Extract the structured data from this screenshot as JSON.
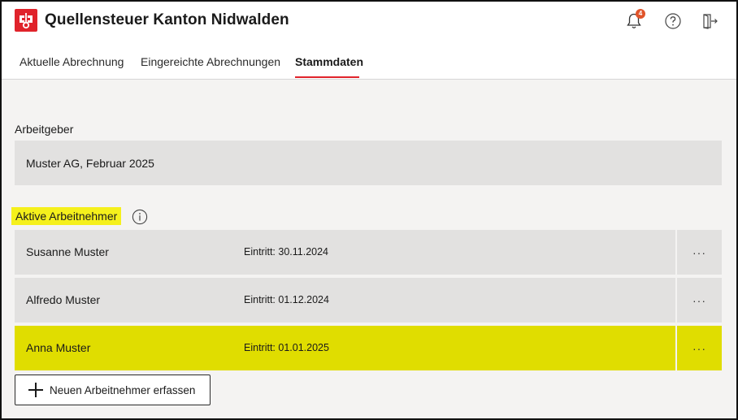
{
  "header": {
    "title": "Quellensteuer Kanton Nidwalden",
    "notification_count": "4",
    "accent_color": "#e0232b"
  },
  "tabs": [
    {
      "label": "Aktuelle Abrechnung",
      "active": false
    },
    {
      "label": "Eingereichte Abrechnungen",
      "active": false
    },
    {
      "label": "Stammdaten",
      "active": true
    }
  ],
  "employer": {
    "label": "Arbeitgeber",
    "value": "Muster AG, Februar 2025"
  },
  "employees": {
    "label": "Aktive Arbeitnehmer",
    "highlight_color": "#e0dd00",
    "rows": [
      {
        "name": "Susanne Muster",
        "entry": "Eintritt: 30.11.2024",
        "more": "···",
        "highlighted": false
      },
      {
        "name": "Alfredo Muster",
        "entry": "Eintritt: 01.12.2024",
        "more": "···",
        "highlighted": false
      },
      {
        "name": "Anna Muster",
        "entry": "Eintritt: 01.01.2025",
        "more": "···",
        "highlighted": true
      }
    ]
  },
  "add_button": {
    "label": "Neuen Arbeitnehmer erfassen"
  }
}
